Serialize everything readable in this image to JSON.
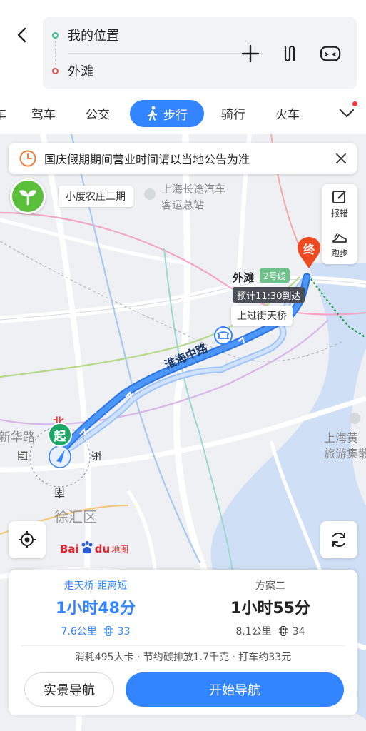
{
  "route": {
    "from": "我的位置",
    "to": "外滩"
  },
  "header_icons": [
    "back-icon",
    "add-icon",
    "route-switch-icon",
    "vr-icon"
  ],
  "tabs": {
    "edge_cut": "车",
    "items": [
      "驾车",
      "公交",
      "骑行",
      "火车"
    ],
    "active": "步行"
  },
  "notice": {
    "text": "国庆假期期间营业时间请以当地公告为准"
  },
  "map": {
    "farm_label": "小度农庄二期",
    "station_label_1": "上海长途汽车",
    "station_label_2": "客运总站",
    "tools": {
      "report": "报错",
      "run": "跑步"
    },
    "destination_name": "外滩",
    "metro_line": "2号线",
    "eta": "预计11:30到达",
    "bridge": "上过街天桥",
    "road": "淮海中路",
    "district_left": "新华路",
    "district": "徐汇区",
    "tourist_1": "上海黄",
    "tourist_2": "旅游集散",
    "compass": {
      "n": "北",
      "e": "东",
      "s": "南",
      "w": "西"
    },
    "start_pin": "起",
    "end_pin": "终",
    "logo": {
      "bai": "Bai",
      "du": "du",
      "map_word": "地图"
    }
  },
  "plans": [
    {
      "tag": "走天桥  距离短",
      "time": "1小时48分",
      "distance": "7.6公里",
      "lights": "33"
    },
    {
      "tag": "方案二",
      "time": "1小时55分",
      "distance": "8.1公里",
      "lights": "34"
    }
  ],
  "stats": "消耗495大卡  ·  节约碳排放1.7千克  ·  打车约33元",
  "buttons": {
    "live_nav": "实景导航",
    "start_nav": "开始导航"
  },
  "colors": {
    "accent": "#3385ff",
    "start": "#1ea665",
    "end": "#ee4a22",
    "route": "#3f8cf5"
  }
}
